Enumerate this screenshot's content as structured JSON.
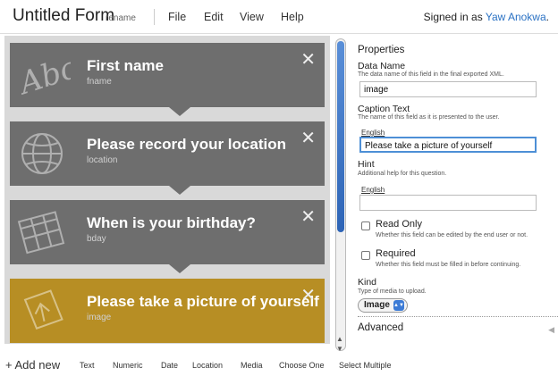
{
  "header": {
    "title": "Untitled Form",
    "rename": "rename",
    "menu": [
      "File",
      "Edit",
      "View",
      "Help"
    ],
    "signed_in_prefix": "Signed in as",
    "user": "Yaw Anokwa",
    "user_suffix": "."
  },
  "questions": [
    {
      "title": "First name",
      "name": "fname",
      "icon": "abc-text-icon",
      "close": "✕",
      "selected": false
    },
    {
      "title": "Please record your location",
      "name": "location",
      "icon": "globe-icon",
      "close": "✕",
      "selected": false
    },
    {
      "title": "When is your birthday?",
      "name": "bday",
      "icon": "calendar-icon",
      "close": "✕",
      "selected": false
    },
    {
      "title": "Please take a picture of yourself",
      "name": "image",
      "icon": "media-upload-icon",
      "close": "✕",
      "selected": true
    }
  ],
  "properties": {
    "heading": "Properties",
    "data_name": {
      "label": "Data Name",
      "hint": "The data name of this field in the final exported XML.",
      "value": "image"
    },
    "caption": {
      "label": "Caption Text",
      "hint": "The name of this field as it is presented to the user.",
      "lang": "English",
      "value": "Please take a picture of yourself"
    },
    "hint": {
      "label": "Hint",
      "hint": "Additional help for this question.",
      "lang": "English",
      "value": ""
    },
    "read_only": {
      "label": "Read Only",
      "hint": "Whether this field can be edited by the end user or not.",
      "checked": false
    },
    "required": {
      "label": "Required",
      "hint": "Whether this field must be filled in before continuing.",
      "checked": false
    },
    "kind": {
      "label": "Kind",
      "hint": "Type of media to upload.",
      "value": "Image"
    },
    "advanced": "Advanced"
  },
  "toolbar": {
    "add_new": "+ Add new",
    "types": [
      "Text",
      "Numeric",
      "Date",
      "Location",
      "Media",
      "Choose One",
      "Select Multiple"
    ]
  },
  "colors": {
    "card": "#6e6e6e",
    "selected_card": "#b78e24",
    "panel_bg": "#d9d9d9",
    "link": "#2b72c4"
  }
}
